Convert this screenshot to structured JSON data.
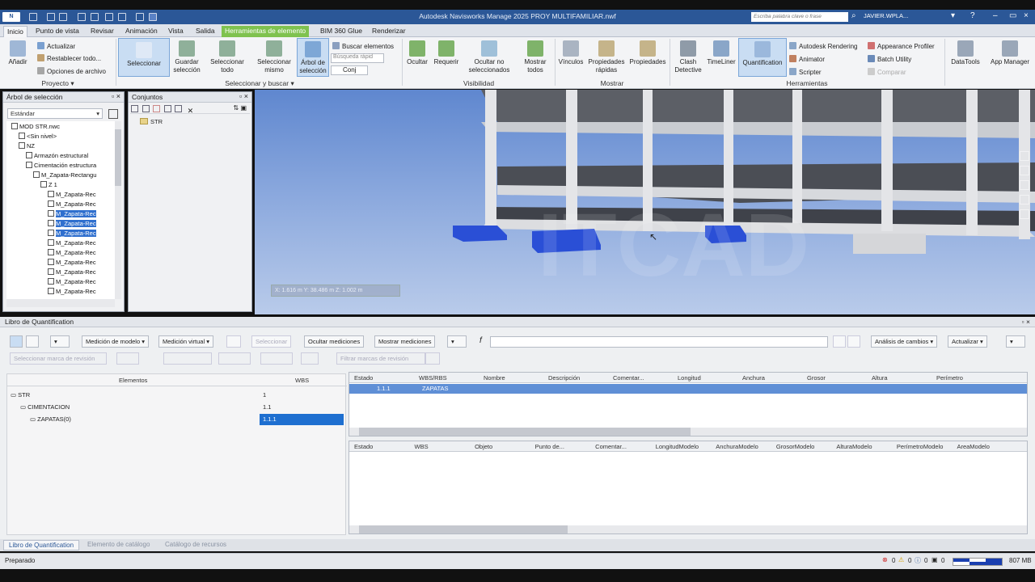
{
  "app": {
    "logo": "N",
    "title": "Autodesk Navisworks Manage 2025   PROY MULTIFAMILIAR.nwf",
    "search_placeholder": "Escriba palabra clave o frase",
    "user": "JAVIER.WPLA...",
    "brand_color": "#2b5797",
    "context_color": "#7fc24f"
  },
  "tabs": [
    {
      "label": "Inicio"
    },
    {
      "label": "Punto de vista"
    },
    {
      "label": "Revisar"
    },
    {
      "label": "Animación"
    },
    {
      "label": "Vista"
    },
    {
      "label": "Salida"
    },
    {
      "label": "Herramientas de elemento"
    },
    {
      "label": "BIM 360 Glue"
    },
    {
      "label": "Renderizar"
    }
  ],
  "ribbon": {
    "anadir": "Añadir",
    "actualizar": "Actualizar",
    "restablecer": "Restablecer todo...",
    "opciones": "Opciones de archivo",
    "proyecto": "Proyecto",
    "seleccionar": "Seleccionar",
    "guardar_sel": "Guardar selección",
    "sel_todo": "Seleccionar todo",
    "sel_mismo": "Seleccionar mismo",
    "arbol_sel": "Árbol de selección",
    "buscar": "Buscar elementos",
    "busqueda_rapida": "Búsqueda rápid",
    "conj": "Conj",
    "sel_buscar": "Seleccionar y buscar",
    "ocultar": "Ocultar",
    "requerir": "Requerir",
    "ocultar_no_sel": "Ocultar no seleccionados",
    "mostrar_todos": "Mostrar todos",
    "visibilidad": "Visibilidad",
    "vinculos": "Vínculos",
    "prop_rapidas": "Propiedades rápidas",
    "propiedades": "Propiedades",
    "mostrar": "Mostrar",
    "clash": "Clash Detective",
    "timeliner": "TimeLiner",
    "quantification": "Quantification",
    "autodesk_rendering": "Autodesk Rendering",
    "animator": "Animator",
    "scripter": "Scripter",
    "appearance_profiler": "Appearance Profiler",
    "batch_utility": "Batch Utility",
    "comparar": "Comparar",
    "datatools": "DataTools",
    "app_manager": "App Manager",
    "herramientas": "Herramientas"
  },
  "selection_tree": {
    "title": "Árbol de selección",
    "mode": "Estándar",
    "rows": [
      {
        "label": "MOD STR.nwc",
        "indent": 0,
        "hl": false
      },
      {
        "label": "<Sin nivel>",
        "indent": 1,
        "hl": false
      },
      {
        "label": "NZ",
        "indent": 1,
        "hl": false
      },
      {
        "label": "Armazón estructural",
        "indent": 2,
        "hl": false
      },
      {
        "label": "Cimentación estructura",
        "indent": 2,
        "hl": false
      },
      {
        "label": "M_Zapata-Rectangu",
        "indent": 3,
        "hl": false
      },
      {
        "label": "Z 1",
        "indent": 4,
        "hl": false
      },
      {
        "label": "M_Zapata-Rec",
        "indent": 5,
        "hl": false
      },
      {
        "label": "M_Zapata-Rec",
        "indent": 5,
        "hl": false
      },
      {
        "label": "M_Zapata-Rec",
        "indent": 5,
        "hl": true
      },
      {
        "label": "M_Zapata-Rec",
        "indent": 5,
        "hl": true
      },
      {
        "label": "M_Zapata-Rec",
        "indent": 5,
        "hl": true
      },
      {
        "label": "M_Zapata-Rec",
        "indent": 5,
        "hl": false
      },
      {
        "label": "M_Zapata-Rec",
        "indent": 5,
        "hl": false
      },
      {
        "label": "M_Zapata-Rec",
        "indent": 5,
        "hl": false
      },
      {
        "label": "M_Zapata-Rec",
        "indent": 5,
        "hl": false
      },
      {
        "label": "M_Zapata-Rec",
        "indent": 5,
        "hl": false
      },
      {
        "label": "M_Zapata-Rec",
        "indent": 5,
        "hl": false
      }
    ]
  },
  "sets_panel": {
    "title": "Conjuntos",
    "item": "STR"
  },
  "viewport": {
    "coords": "X: 1.616 m  Y: 38.486 m  Z: 1.002 m",
    "watermark": "ITCAD"
  },
  "quantification": {
    "title": "Libro de Quantification",
    "toolbar": {
      "medicion_modelo": "Medición de modelo",
      "medicion_virtual": "Medición virtual",
      "seleccionar": "Seleccionar",
      "ocultar_mediciones": "Ocultar mediciones",
      "mostrar_mediciones": "Mostrar mediciones",
      "analisis_cambios": "Análisis de cambios",
      "actualizar": "Actualizar",
      "sel_marca": "Seleccionar marca de revisión",
      "filtrar": "Filtrar marcas de revisión"
    },
    "left_headers": {
      "elements": "Elementos",
      "wbs": "WBS"
    },
    "left_rows": [
      {
        "name": "STR",
        "wbs": "1",
        "indent": 0,
        "sel": false
      },
      {
        "name": "CIMENTACION",
        "wbs": "1.1",
        "indent": 1,
        "sel": false
      },
      {
        "name": "ZAPATAS(0)",
        "wbs": "1.1.1",
        "indent": 2,
        "sel": true
      }
    ],
    "grid1_headers": [
      "Estado",
      "WBS/RBS",
      "Nombre",
      "Descripción",
      "Comentar...",
      "Longitud",
      "Anchura",
      "Grosor",
      "Altura",
      "Perímetro"
    ],
    "grid1_row": {
      "wbs": "1.1.1",
      "name": "ZAPATAS"
    },
    "grid2_headers": [
      "Estado",
      "WBS",
      "Objeto",
      "Punto de...",
      "Comentar...",
      "LongitudModelo",
      "AnchuraModelo",
      "GrosorModelo",
      "AlturaModelo",
      "PerímetroModelo",
      "AreaModelo"
    ]
  },
  "bottom_tabs": [
    "Libro de Quantification",
    "Elemento de catálogo",
    "Catálogo de recursos"
  ],
  "status": {
    "text": "Preparado",
    "counts": [
      "0",
      "0",
      "0",
      "0"
    ],
    "memory": "807 MB"
  }
}
